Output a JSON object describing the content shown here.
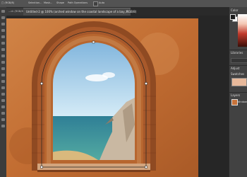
{
  "options_bar": {
    "items": [
      "□ (RGB/8)",
      "Selection...",
      "Mask...",
      "Shape",
      "Path Operations"
    ],
    "checkbox_label": "Auto"
  },
  "document": {
    "left_tab_label": "...ck (RGB/8) ×",
    "tab_title": "Untitled-2 @ 100% (arched window on the coastal landscape of a bay, RGB/8)",
    "close_glyph": "×"
  },
  "panels": {
    "color_header": "Color",
    "libraries_header": "Libraries",
    "adjust_header": "Adjust",
    "swatches_header": "Swatches",
    "layers_header": "Layers",
    "layer_name": "Window",
    "foreground_color": "#1a1a1a",
    "background_color": "#ffffff",
    "swatch_color": "#e8b99b"
  },
  "tools": [
    "move-icon",
    "marquee-icon",
    "lasso-icon",
    "crop-icon",
    "eyedropper-icon",
    "heal-icon",
    "brush-icon",
    "stamp-icon",
    "history-brush-icon",
    "eraser-icon",
    "gradient-icon",
    "blur-icon",
    "dodge-icon",
    "pen-icon",
    "type-icon",
    "path-select-icon",
    "shape-icon",
    "hand-icon",
    "zoom-icon"
  ],
  "theme": {
    "wall": "#c8733a",
    "brick": "#9a4d24",
    "sky": "#a9cfe6",
    "sea": "#3f95a8",
    "cliff": "#c9b8a2"
  }
}
